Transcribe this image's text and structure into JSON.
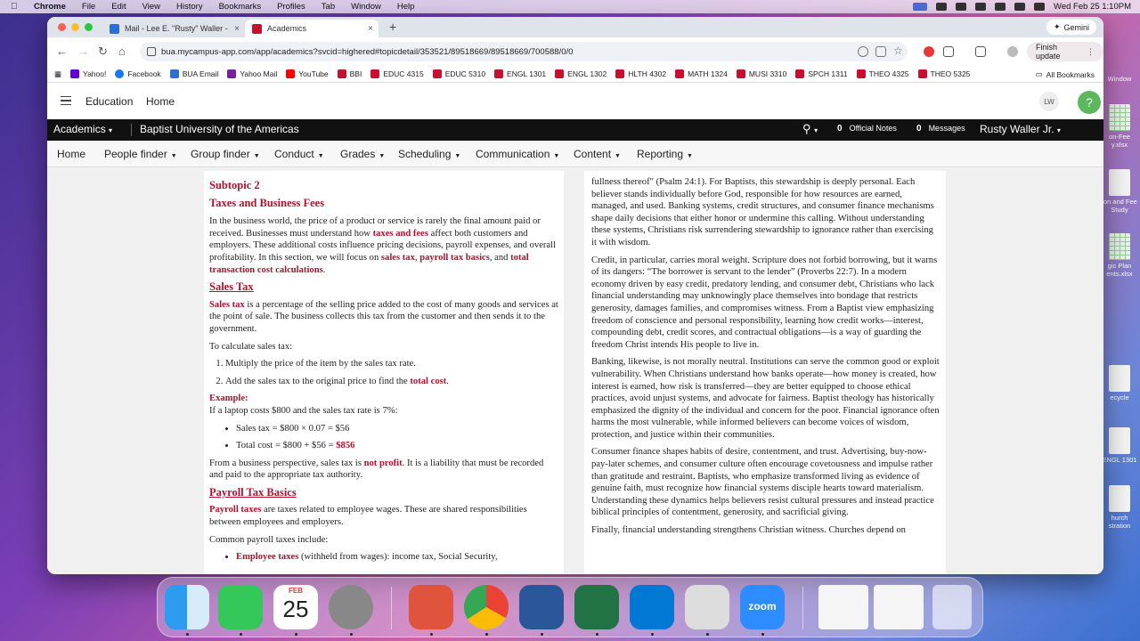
{
  "menubar": {
    "app": "Chrome",
    "items": [
      "File",
      "Edit",
      "View",
      "History",
      "Bookmarks",
      "Profiles",
      "Tab",
      "Window",
      "Help"
    ],
    "datetime": "Wed Feb 25  1:10PM"
  },
  "desktop": [
    {
      "label": "on-Fee\ny.xlsx"
    },
    {
      "label": "ion and Fee\nStudy"
    },
    {
      "label": "gic Plan\nents.xlsx"
    },
    {
      "label": "ecycle"
    },
    {
      "label": "ENGL 1301"
    },
    {
      "label": "hurch\nstration"
    },
    {
      "label": "Window"
    }
  ],
  "browser": {
    "tabs": [
      {
        "title": "Mail - Lee E. \"Rusty\" Waller -"
      },
      {
        "title": "Academics"
      }
    ],
    "gemini": "Gemini",
    "url": "bua.mycampus-app.com/app/academics?svcid=highered#topicdetail/353521/89518669/89518669/700588/0/0",
    "finish_update": "Finish update",
    "bookmarks": [
      "Yahoo!",
      "Facebook",
      "BUA Email",
      "Yahoo Mail",
      "YouTube",
      "BBI",
      "EDUC 4315",
      "EDUC 5310",
      "ENGL 1301",
      "ENGL 1302",
      "HLTH 4302",
      "MATH 1324",
      "MUSI 3310",
      "SPCH 1311",
      "THEO 4325",
      "THEO 5325"
    ],
    "all_bookmarks": "All Bookmarks"
  },
  "app": {
    "header": {
      "title": "Education",
      "home": "Home",
      "avatar": "LW",
      "help": "?"
    },
    "darkbar": {
      "menu": "Academics",
      "university": "Baptist University of the Americas",
      "notes_count": "0",
      "notes_label": "Official Notes",
      "messages_count": "0",
      "messages_label": "Messages",
      "user": "Rusty Waller Jr."
    },
    "nav": [
      "Home",
      "People finder",
      "Group finder",
      "Conduct",
      "Grades",
      "Scheduling",
      "Communication",
      "Content",
      "Reporting"
    ]
  },
  "left": {
    "subtopic": "Subtopic 2",
    "title": "Taxes and Business Fees",
    "intro_a": "In the business world, the price of a product or service is rarely the final amount paid or received. Businesses must understand how ",
    "intro_b": "taxes and fees",
    "intro_c": " affect both customers and employers. These additional costs influence pricing decisions, payroll expenses, and overall profitability. In this section, we will focus on ",
    "intro_d": "sales tax",
    "intro_e": ", ",
    "intro_f": "payroll tax basics",
    "intro_g": ", and ",
    "intro_h": "total transaction cost calculations",
    "intro_i": ".",
    "sales_head": "Sales Tax",
    "sales_a": "Sales tax",
    "sales_b": " is a percentage of the selling price added to the cost of many goods and services at the point of sale. The business collects this tax from the customer and then sends it to the government.",
    "calc_label": "To calculate sales tax:",
    "step1": "Multiply the price of the item by the sales tax rate.",
    "step2a": "Add the sales tax to the original price to find the ",
    "step2b": "total cost",
    "step2c": ".",
    "example_label": "Example:",
    "example_text": "If a laptop costs $800 and the sales tax rate is 7%:",
    "bullet1": "Sales tax = $800 × 0.07 = $56",
    "bullet2a": "Total cost = $800 + $56 = ",
    "bullet2b": "$856",
    "profit_a": "From a business perspective, sales tax is ",
    "profit_b": "not profit",
    "profit_c": ". It is a liability that must be recorded and paid to the appropriate tax authority.",
    "payroll_head": "Payroll Tax Basics",
    "payroll_a": "Payroll taxes",
    "payroll_b": " are taxes related to employee wages. These are shared responsibilities between employees and employers.",
    "common_label": "Common payroll taxes include:",
    "emp_a": "Employee taxes",
    "emp_b": " (withheld from wages): income tax, Social Security,"
  },
  "right": {
    "p1": "fullness thereof\" (Psalm 24:1). For Baptists, this stewardship is deeply personal. Each believer stands individually before God, responsible for how resources are earned, managed, and used. Banking systems, credit structures, and consumer finance mechanisms shape daily decisions that either honor or undermine this calling. Without understanding these systems, Christians risk surrendering stewardship to ignorance rather than exercising it with wisdom.",
    "p2": "Credit, in particular, carries moral weight. Scripture does not forbid borrowing, but it warns of its dangers: “The borrower is servant to the lender” (Proverbs 22:7). In a modern economy driven by easy credit, predatory lending, and consumer debt, Christians who lack financial understanding may unknowingly place themselves into bondage that restricts generosity, damages families, and compromises witness. From a Baptist view emphasizing freedom of conscience and personal responsibility, learning how credit works—interest, compounding debt, credit scores, and contractual obligations—is a way of guarding the freedom Christ intends His people to live in.",
    "p3": "Banking, likewise, is not morally neutral. Institutions can serve the common good or exploit vulnerability. When Christians understand how banks operate—how money is created, how interest is earned, how risk is transferred—they are better equipped to choose ethical practices, avoid unjust systems, and advocate for fairness. Baptist theology has historically emphasized the dignity of the individual and concern for the poor. Financial ignorance often harms the most vulnerable, while informed believers can become voices of wisdom, protection, and justice within their communities.",
    "p4": "Consumer finance shapes habits of desire, contentment, and trust. Advertising, buy-now-pay-later schemes, and consumer culture often encourage covetousness and impulse rather than gratitude and restraint. Baptists, who emphasize transformed living as evidence of genuine faith, must recognize how financial systems disciple hearts toward materialism. Understanding these dynamics helps believers resist cultural pressures and instead practice biblical principles of contentment, generosity, and sacrificial giving.",
    "p5": "Finally, financial understanding strengthens Christian witness. Churches depend on"
  },
  "dock": {
    "calendar_month": "FEB",
    "calendar_day": "25",
    "zoom": "zoom"
  }
}
